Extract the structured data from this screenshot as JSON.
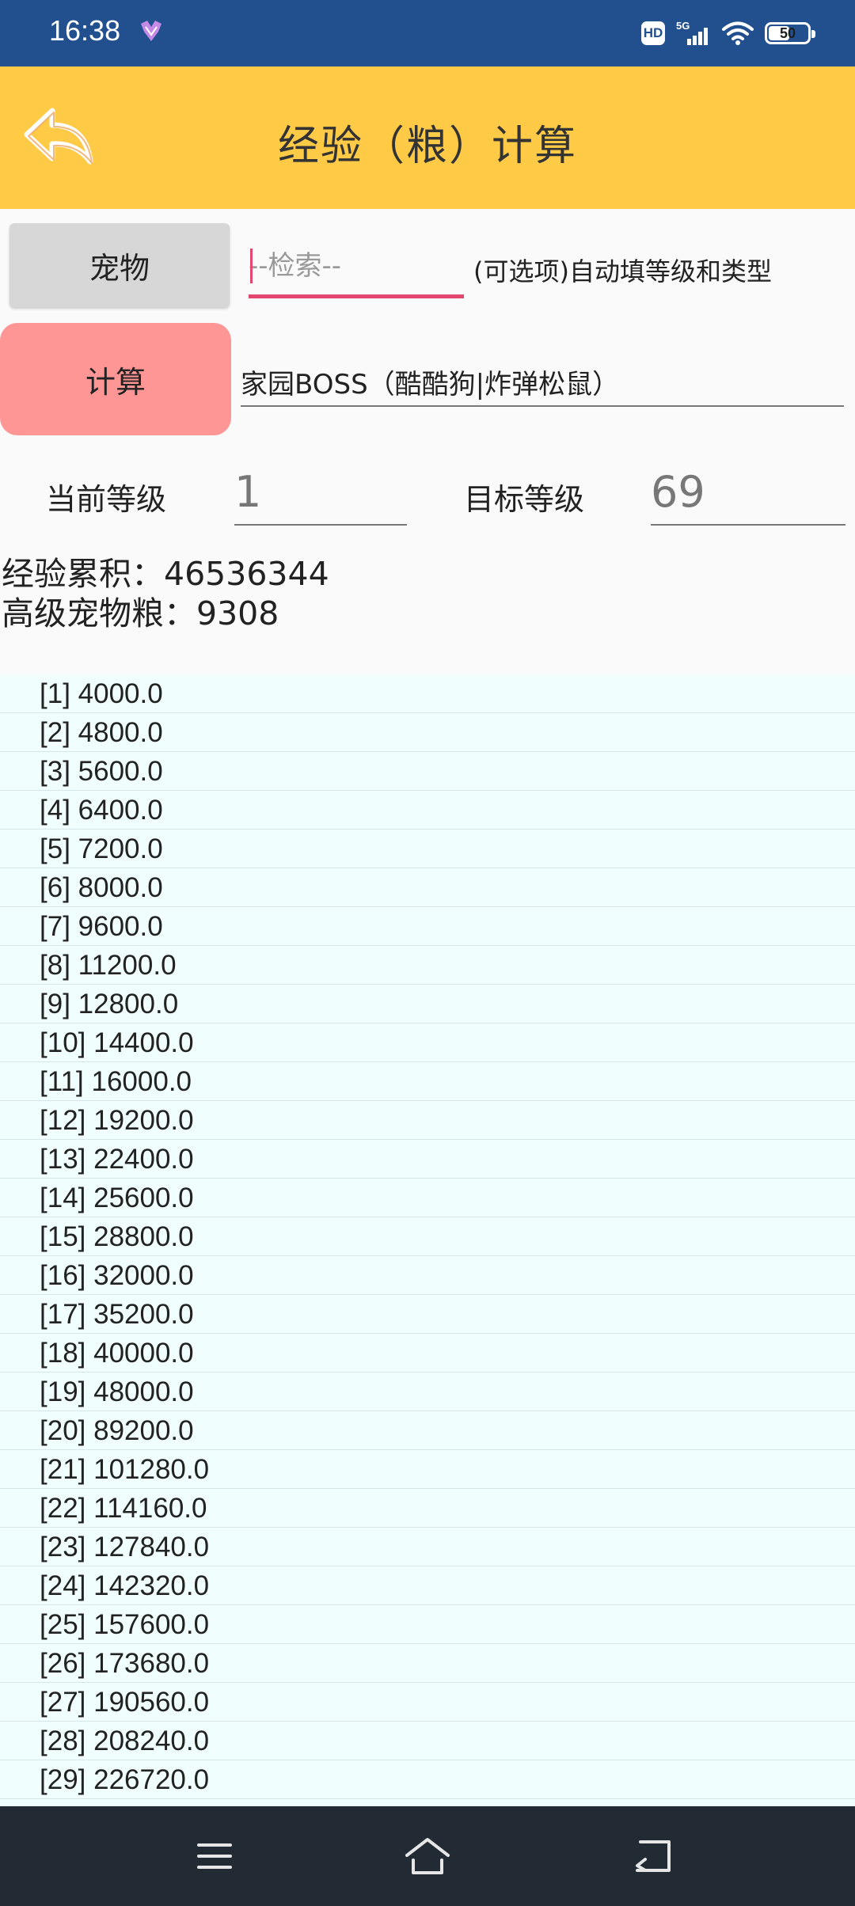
{
  "status_bar": {
    "time": "16:38",
    "hd_badge": "HD",
    "network": "5G",
    "battery": "50"
  },
  "header": {
    "title": "经验（粮）计算"
  },
  "controls": {
    "pet_button": "宠物",
    "search_placeholder": "--检索--",
    "search_hint": "(可选项)自动填等级和类型",
    "calc_button": "计算",
    "pet_type": "家园BOSS（酷酷狗|炸弹松鼠）",
    "current_level_label": "当前等级",
    "current_level_value": "1",
    "target_level_label": "目标等级",
    "target_level_value": "69"
  },
  "summary": {
    "exp_total": "经验累积：46536344",
    "food_total": "高级宠物粮：9308"
  },
  "levels": [
    "[1] 4000.0",
    "[2] 4800.0",
    "[3] 5600.0",
    "[4] 6400.0",
    "[5] 7200.0",
    "[6] 8000.0",
    "[7] 9600.0",
    "[8] 11200.0",
    "[9] 12800.0",
    "[10] 14400.0",
    "[11] 16000.0",
    "[12] 19200.0",
    "[13] 22400.0",
    "[14] 25600.0",
    "[15] 28800.0",
    "[16] 32000.0",
    "[17] 35200.0",
    "[18] 40000.0",
    "[19] 48000.0",
    "[20] 89200.0",
    "[21] 101280.0",
    "[22] 114160.0",
    "[23] 127840.0",
    "[24] 142320.0",
    "[25] 157600.0",
    "[26] 173680.0",
    "[27] 190560.0",
    "[28] 208240.0",
    "[29] 226720.0"
  ],
  "colors": {
    "status_bar": "#22508f",
    "header": "#ffcb47",
    "calc_button": "#ff9696",
    "pet_button": "#d7d7d7",
    "search_underline": "#e2486f",
    "list_bg": "#f0fefe",
    "nav_bar": "#222a33"
  },
  "icons": {
    "back": "back-arrow-icon",
    "menu": "menu-icon",
    "home": "home-icon",
    "nav_back": "nav-back-icon"
  }
}
